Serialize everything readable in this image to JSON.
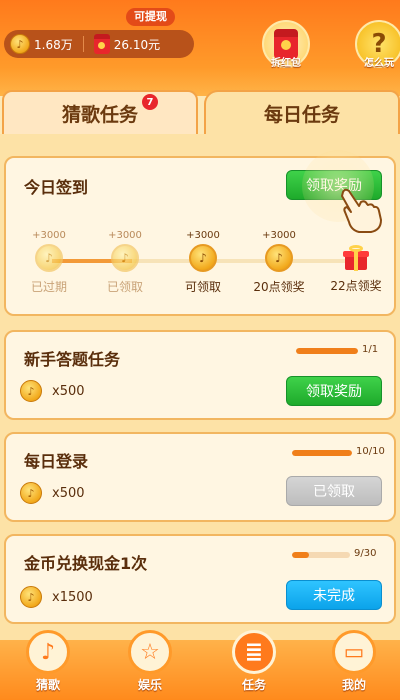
{
  "header": {
    "coin_balance": "1.68万",
    "cash_balance": "26.10元",
    "withdraw_tag": "可提现",
    "redpacket_label": "拆红包",
    "help_label": "怎么玩",
    "help_glyph": "?"
  },
  "tabs": [
    {
      "label": "猜歌任务",
      "badge": "7"
    },
    {
      "label": "每日任务"
    }
  ],
  "signin": {
    "title": "今日签到",
    "button": "领取奖励",
    "days": [
      {
        "plus": "+3000",
        "label": "已过期"
      },
      {
        "plus": "+3000",
        "label": "已领取"
      },
      {
        "plus": "+3000",
        "label": "可领取"
      },
      {
        "plus": "+3000",
        "label": "20点领奖"
      },
      {
        "label": "22点领奖"
      }
    ]
  },
  "tasks": [
    {
      "title": "新手答题任务",
      "reward": "x500",
      "progress_text": "1/1",
      "progress": 1.0,
      "button": "领取奖励",
      "state": "claimable"
    },
    {
      "title": "每日登录",
      "reward": "x500",
      "progress_text": "10/10",
      "progress": 1.0,
      "button": "已领取",
      "state": "claimed"
    },
    {
      "title": "金币兑换现金1次",
      "reward": "x1500",
      "progress_text": "9/30",
      "progress": 0.3,
      "button": "未完成",
      "state": "incomplete"
    }
  ],
  "nav": [
    {
      "label": "猜歌",
      "icon": "music-note-icon"
    },
    {
      "label": "娱乐",
      "icon": "star-icon"
    },
    {
      "label": "任务",
      "icon": "clipboard-icon"
    },
    {
      "label": "我的",
      "icon": "wallet-icon"
    }
  ],
  "colors": {
    "accent": "#ff7a1c",
    "green": "#1eaa2b",
    "blue": "#0ba3ea",
    "gray": "#bdbdbd",
    "progress": "#f07f1a"
  }
}
